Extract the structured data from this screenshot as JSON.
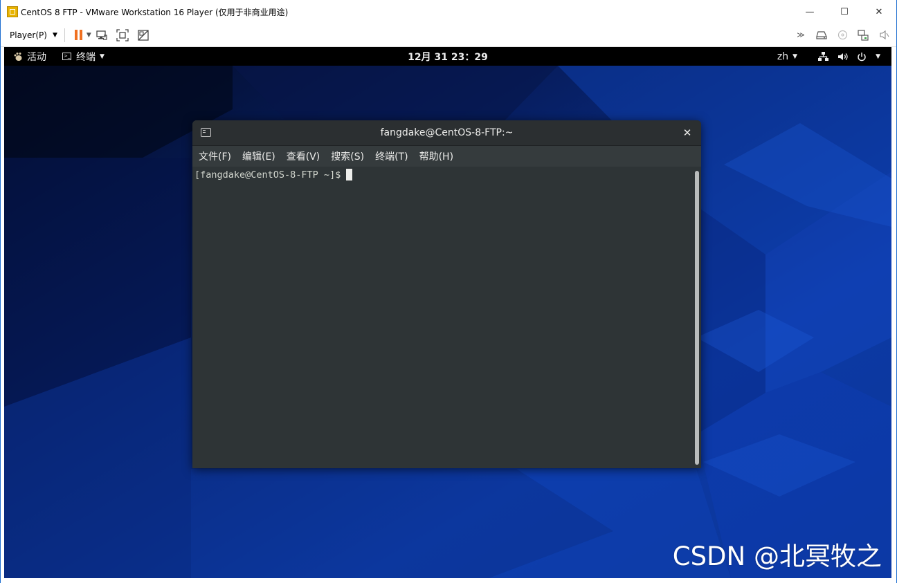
{
  "vm": {
    "title": "CentOS 8 FTP - VMware Workstation 16 Player (仅用于非商业用途)",
    "player_menu": "Player(P)",
    "window_controls": {
      "minimize": "—",
      "maximize": "☐",
      "close": "✕"
    }
  },
  "gnome": {
    "activities": "活动",
    "app_menu": "终端",
    "clock": "12月 31  23：29",
    "language": "zh",
    "status_icons": [
      "network-icon",
      "volume-icon",
      "power-icon"
    ]
  },
  "terminal": {
    "title": "fangdake@CentOS-8-FTP:~",
    "close": "✕",
    "menus": [
      "文件(F)",
      "编辑(E)",
      "查看(V)",
      "搜索(S)",
      "终端(T)",
      "帮助(H)"
    ],
    "prompt": "[fangdake@CentOS-8-FTP ~]$"
  },
  "watermark": "CSDN @北冥牧之",
  "colors": {
    "terminal_bg": "#2e3436",
    "gnome_topbar": "#000000",
    "wallpaper_blue": "#0b3aa0",
    "pause_orange": "#f07020"
  }
}
